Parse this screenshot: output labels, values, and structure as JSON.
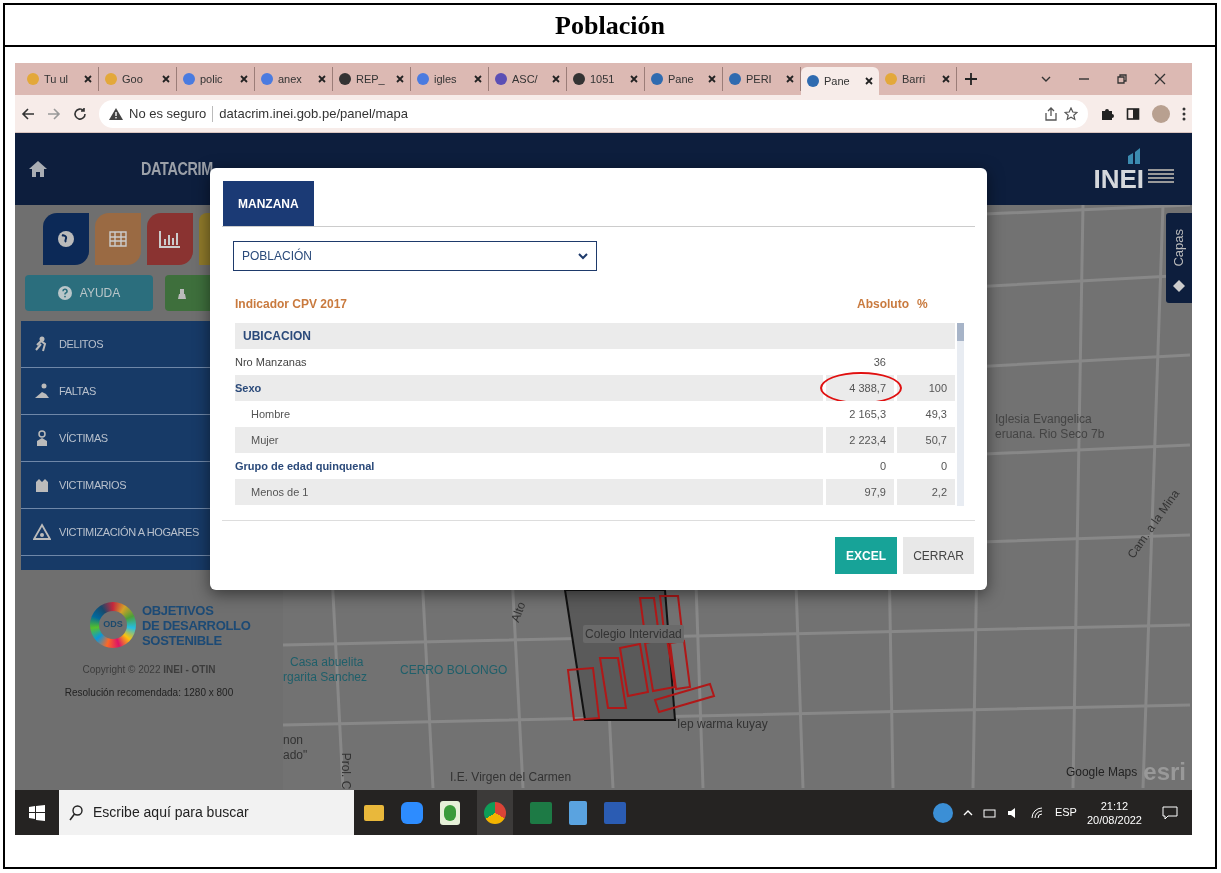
{
  "document": {
    "title": "Población"
  },
  "browser": {
    "tabs": [
      {
        "title": "Tu ul",
        "selected": false
      },
      {
        "title": "Goo",
        "selected": false
      },
      {
        "title": "polic",
        "selected": false
      },
      {
        "title": "anex",
        "selected": false
      },
      {
        "title": "REP_",
        "selected": false
      },
      {
        "title": "igles",
        "selected": false
      },
      {
        "title": "ASC/",
        "selected": false
      },
      {
        "title": "1051",
        "selected": false
      },
      {
        "title": "Pane",
        "selected": false
      },
      {
        "title": "PERI",
        "selected": false
      },
      {
        "title": "Pane",
        "selected": true
      },
      {
        "title": "Barri",
        "selected": false
      }
    ],
    "security": "No es seguro",
    "url": "datacrim.inei.gob.pe/panel/mapa"
  },
  "site": {
    "title": "DATACRIM",
    "logo": "INEI",
    "help_button": "AYUDA",
    "menu": [
      {
        "label": "DELITOS"
      },
      {
        "label": "FALTAS"
      },
      {
        "label": "VÍCTIMAS"
      },
      {
        "label": "VICTIMARIOS"
      },
      {
        "label": "VICTIMIZACIÓN A HOGARES"
      }
    ],
    "sdg_ring": "ODS",
    "sdg_lines": [
      "OBJETIVOS",
      "DE DESARROLLO",
      "SOSTENIBLE"
    ],
    "copyright": "Copyright © 2022 **INEI - OTIN**",
    "resolution": "Resolución recomendada: 1280 x 800",
    "layers_tab": "Capas"
  },
  "map": {
    "labels": [
      "Iglesia Evangelica",
      "eruana. Rio Seco 7b",
      "Casa abuelita",
      "rgarita Sanchez",
      "CERRO BOLONGO",
      "Colegio Intervidad",
      "Iep warma kuyay",
      "non",
      "ado\"",
      "I.E. Virgen del Carmen",
      "Prol. C",
      "Alto",
      "Cam. a la Mina"
    ],
    "attribution": "Google Maps",
    "esri": "esri"
  },
  "modal": {
    "tabs": [
      {
        "label": "MANZANA",
        "selected": true
      }
    ],
    "select": {
      "value": "POBLACIÓN"
    },
    "columns": [
      "Indicador CPV 2017",
      "Absoluto",
      "%"
    ],
    "rows": [
      {
        "kind": "section",
        "label": "UBICACION"
      },
      {
        "kind": "item",
        "label": "Nro Manzanas",
        "absolute": "36"
      },
      {
        "kind": "group",
        "label": "Sexo",
        "absolute": "4 388,7",
        "percent": "100",
        "circled": true,
        "children": [
          {
            "label": "Hombre",
            "absolute": "2 165,3",
            "percent": "49,3"
          },
          {
            "label": "Mujer",
            "absolute": "2 223,4",
            "percent": "50,7"
          }
        ]
      },
      {
        "kind": "group",
        "label": "Grupo de edad quinquenal",
        "absolute": "0",
        "percent": "0",
        "circled": false,
        "children": [
          {
            "label": "Menos de 1",
            "absolute": "97,9",
            "percent": "2,2"
          }
        ]
      }
    ],
    "buttons": [
      {
        "label": "EXCEL",
        "kind": "primary"
      },
      {
        "label": "CERRAR",
        "kind": "secondary"
      }
    ]
  },
  "taskbar": {
    "search_placeholder": "Escribe aquí para buscar",
    "language": "ESP",
    "time": "21:12",
    "date": "20/08/2022"
  }
}
